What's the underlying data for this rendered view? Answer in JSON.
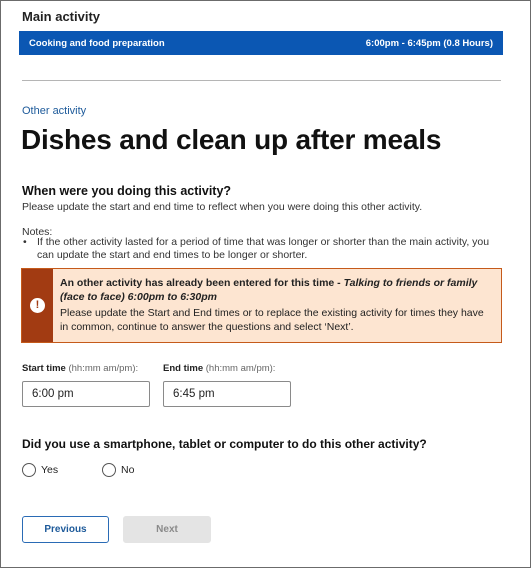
{
  "main_activity": {
    "label": "Main activity",
    "name": "Cooking and food preparation",
    "time": "6:00pm - 6:45pm (0.8 Hours)"
  },
  "other_activity": {
    "kicker": "Other activity",
    "title": "Dishes and clean up after meals"
  },
  "when_question": {
    "label": "When were you doing this activity?",
    "hint": "Please update the start and end time to reflect when you were doing this other activity.",
    "notes_label": "Notes:",
    "notes": [
      "If the other activity lasted for a period of time that was longer or shorter than the main activity, you can update the start and end times to be longer or shorter."
    ]
  },
  "warning": {
    "icon": "exclamation-icon",
    "heading_prefix": "An other activity has already been entered for this time - ",
    "heading_italic": "Talking to friends or family (face to face) 6:00pm to 6:30pm",
    "text": "Please update the Start and End times or to replace the existing activity for times they have in common, continue to answer the questions and select ‘Next’.",
    "colors": {
      "border": "#c55a1a",
      "side": "#a23b12",
      "background": "#fde5d1"
    }
  },
  "start_time": {
    "label": "Start time",
    "format": "(hh:mm am/pm):",
    "value": "6:00 pm"
  },
  "end_time": {
    "label": "End time",
    "format": "(hh:mm am/pm):",
    "value": "6:45 pm"
  },
  "device_question": {
    "label": "Did you use a smartphone, tablet or computer to do this other activity?",
    "options": [
      "Yes",
      "No"
    ],
    "selected": null
  },
  "buttons": {
    "previous": "Previous",
    "next": "Next",
    "next_disabled": true
  },
  "colors": {
    "accent": "#0b57b3",
    "link": "#1d5a9a"
  }
}
